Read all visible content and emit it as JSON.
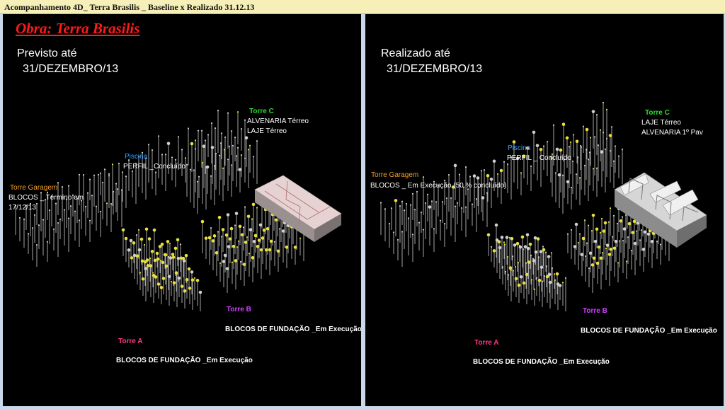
{
  "window": {
    "title": "Acompanhamento 4D_ Terra Brasilis _ Baseline x Realizado 31.12.13"
  },
  "left": {
    "obra": "Obra: Terra Brasilis",
    "heading_line1": "Previsto até",
    "heading_line2": "31/DEZEMBRO/13",
    "torre_c": {
      "title": "Torre C",
      "line1": "ALVENARIA  Térreo",
      "line2": "LAJE   Térreo"
    },
    "piscina": {
      "title": "Piscina",
      "line1": "PERFIL _Concluído"
    },
    "garagem": {
      "title": "Torre Garagem",
      "line1": "BLOCOS _ Término em",
      "line2": "17/12/13"
    },
    "torre_b": {
      "title": "Torre B",
      "status": "BLOCOS DE FUNDAÇÃO _Em Execução"
    },
    "torre_a": {
      "title": "Torre A",
      "status": "BLOCOS DE FUNDAÇÃO _Em Execução"
    }
  },
  "right": {
    "heading_line1": "Realizado até",
    "heading_line2": "31/DEZEMBRO/13",
    "torre_c": {
      "title": "Torre C",
      "line1": "LAJE  Térreo",
      "line2": "ALVENARIA  1º Pav"
    },
    "piscina": {
      "title": "Piscina",
      "line1": "PERFIL _ Concluído"
    },
    "garagem": {
      "title": "Torre Garagem",
      "line1": "BLOCOS _ Em Execução  (50 % concluído)"
    },
    "torre_b": {
      "title": "Torre B",
      "status": "BLOCOS DE FUNDAÇÃO _Em Execução"
    },
    "torre_a": {
      "title": "Torre A",
      "status": "BLOCOS DE FUNDAÇÃO _Em Execução"
    }
  },
  "colors": {
    "titlebar_bg": "#f6efb8",
    "panel_bg": "#000000",
    "obra_red": "#ff1a1a",
    "torre_c_green": "#2fdc2f",
    "piscina_blue": "#3aa0ff",
    "garagem_orange": "#f0a030",
    "torre_a_pink": "#ff3a88",
    "torre_b_purple": "#d040ff",
    "pile_gray": "#b8b8b8",
    "pile_cap_yellow": "#e8e040",
    "slab_pink": "#e8d4d4",
    "slab_gray": "#d0d0d0"
  }
}
